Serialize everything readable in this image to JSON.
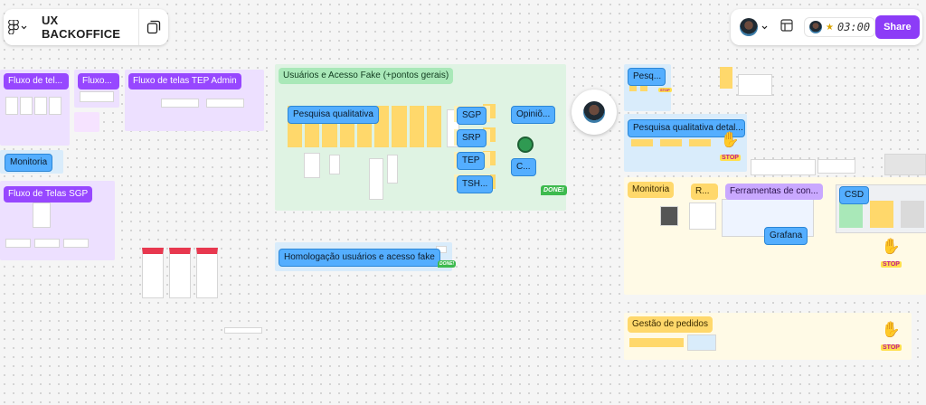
{
  "toolbar": {
    "file_title": "UX BACKOFFICE",
    "timer": "03:00",
    "share_label": "Share"
  },
  "sections": {
    "fluxo_tel": "Fluxo de tel...",
    "fluxo_short": "Fluxo...",
    "fluxo_tep_admin": "Fluxo de telas TEP Admin",
    "monitoria_left": "Monitoria",
    "fluxo_sgp": "Fluxo de Telas SGP",
    "usuarios_acesso": "Usuários e Acesso Fake (+pontos gerais)",
    "pesquisa_qualitativa": "Pesquisa qualitativa",
    "sgp": "SGP",
    "srp": "SRP",
    "tep": "TEP",
    "tsh": "TSH...",
    "opiniao": "Opiniõ...",
    "c": "C...",
    "homologacao": "Homologação usuários e acesso fake",
    "pesq_short": "Pesq...",
    "pesquisa_detal": "Pesquisa qualitativa detal...",
    "monitoria_right": "Monitoria",
    "r": "R...",
    "ferramentas": "Ferramentas de con...",
    "csd": "CSD",
    "grafana": "Grafana",
    "gestao_pedidos": "Gestão de pedidos"
  },
  "stickers": {
    "stop": "STOP",
    "done": "DONE!"
  },
  "colors": {
    "accent": "#8c3cf7",
    "section_purple": "#ede0ff",
    "section_green": "#dff3e3",
    "section_blue": "#d9ecfb",
    "section_yellow": "#fffae6"
  },
  "icons": {
    "figma": "figma-logo-icon",
    "pages": "pages-icon",
    "layout": "layout-icon",
    "chevron": "chevron-down-icon"
  }
}
